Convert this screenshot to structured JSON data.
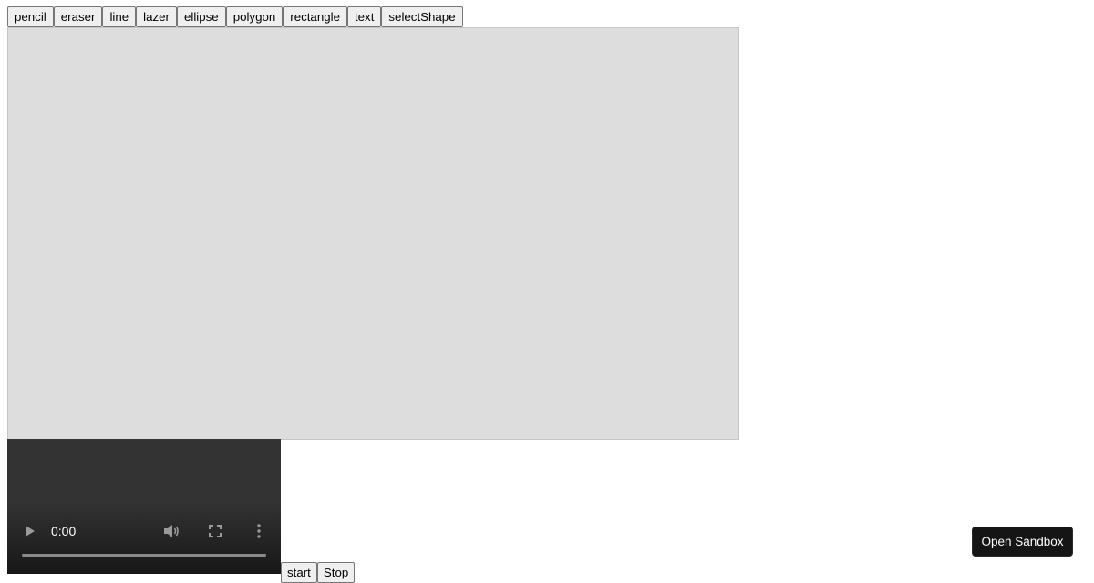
{
  "toolbar": {
    "tools": [
      "pencil",
      "eraser",
      "line",
      "lazer",
      "ellipse",
      "polygon",
      "rectangle",
      "text",
      "selectShape"
    ]
  },
  "video": {
    "time": "0:00",
    "icons": {
      "play": "play-icon",
      "volume": "volume-icon",
      "fullscreen": "fullscreen-icon",
      "more": "more-vert-icon"
    },
    "progress": 0
  },
  "recording": {
    "start_label": "start",
    "stop_label": "Stop"
  },
  "sandbox": {
    "open_label": "Open Sandbox"
  },
  "colors": {
    "canvas_bg": "#dddddd",
    "video_bg": "#333333",
    "sandbox_bg": "#151515"
  }
}
